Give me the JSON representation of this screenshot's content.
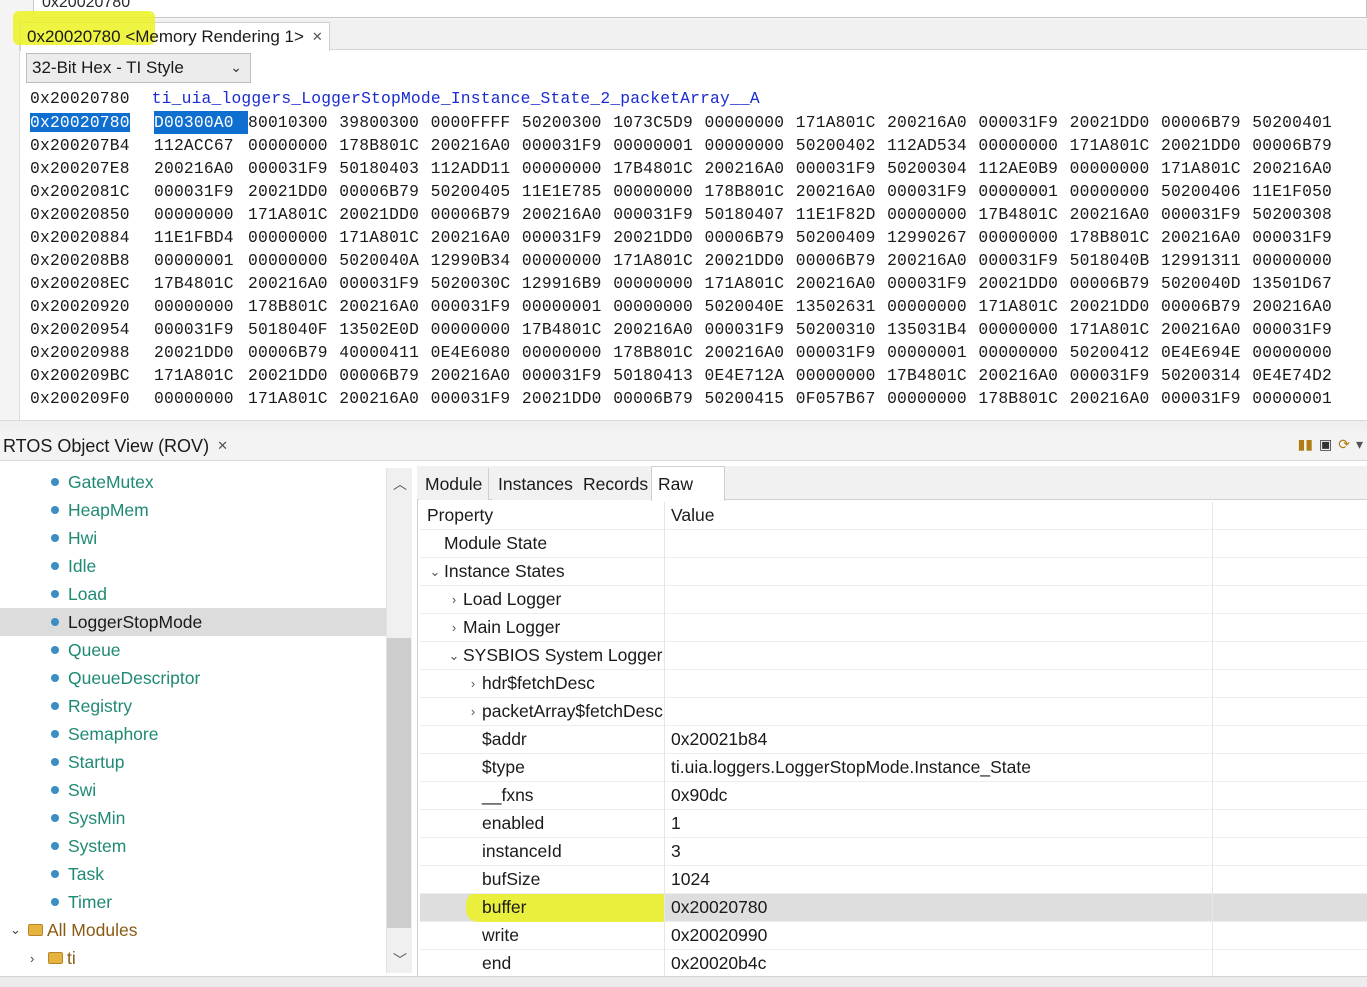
{
  "address_input": {
    "value": "0x20020780"
  },
  "memory_view": {
    "tab_title": "0x20020780 <Memory Rendering 1>",
    "format": "32-Bit Hex - TI Style",
    "label_row": {
      "address": "0x20020780",
      "symbol": "ti_uia_loggers_LoggerStopMode_Instance_State_2_packetArray__A"
    },
    "rows": [
      {
        "address": "0x20020780",
        "words": [
          "D00300A0",
          "80010300",
          "39800300",
          "0000FFFF",
          "50200300",
          "1073C5D9",
          "00000000",
          "171A801C",
          "200216A0",
          "000031F9",
          "20021DD0",
          "00006B79",
          "50200401"
        ]
      },
      {
        "address": "0x200207B4",
        "words": [
          "112ACC67",
          "00000000",
          "178B801C",
          "200216A0",
          "000031F9",
          "00000001",
          "00000000",
          "50200402",
          "112AD534",
          "00000000",
          "171A801C",
          "20021DD0",
          "00006B79"
        ]
      },
      {
        "address": "0x200207E8",
        "words": [
          "200216A0",
          "000031F9",
          "50180403",
          "112ADD11",
          "00000000",
          "17B4801C",
          "200216A0",
          "000031F9",
          "50200304",
          "112AE0B9",
          "00000000",
          "171A801C",
          "200216A0"
        ]
      },
      {
        "address": "0x2002081C",
        "words": [
          "000031F9",
          "20021DD0",
          "00006B79",
          "50200405",
          "11E1E785",
          "00000000",
          "178B801C",
          "200216A0",
          "000031F9",
          "00000001",
          "00000000",
          "50200406",
          "11E1F050"
        ]
      },
      {
        "address": "0x20020850",
        "words": [
          "00000000",
          "171A801C",
          "20021DD0",
          "00006B79",
          "200216A0",
          "000031F9",
          "50180407",
          "11E1F82D",
          "00000000",
          "17B4801C",
          "200216A0",
          "000031F9",
          "50200308"
        ]
      },
      {
        "address": "0x20020884",
        "words": [
          "11E1FBD4",
          "00000000",
          "171A801C",
          "200216A0",
          "000031F9",
          "20021DD0",
          "00006B79",
          "50200409",
          "12990267",
          "00000000",
          "178B801C",
          "200216A0",
          "000031F9"
        ]
      },
      {
        "address": "0x200208B8",
        "words": [
          "00000001",
          "00000000",
          "5020040A",
          "12990B34",
          "00000000",
          "171A801C",
          "20021DD0",
          "00006B79",
          "200216A0",
          "000031F9",
          "5018040B",
          "12991311",
          "00000000"
        ]
      },
      {
        "address": "0x200208EC",
        "words": [
          "17B4801C",
          "200216A0",
          "000031F9",
          "5020030C",
          "129916B9",
          "00000000",
          "171A801C",
          "200216A0",
          "000031F9",
          "20021DD0",
          "00006B79",
          "5020040D",
          "13501D67"
        ]
      },
      {
        "address": "0x20020920",
        "words": [
          "00000000",
          "178B801C",
          "200216A0",
          "000031F9",
          "00000001",
          "00000000",
          "5020040E",
          "13502631",
          "00000000",
          "171A801C",
          "20021DD0",
          "00006B79",
          "200216A0"
        ]
      },
      {
        "address": "0x20020954",
        "words": [
          "000031F9",
          "5018040F",
          "13502E0D",
          "00000000",
          "17B4801C",
          "200216A0",
          "000031F9",
          "50200310",
          "135031B4",
          "00000000",
          "171A801C",
          "200216A0",
          "000031F9"
        ]
      },
      {
        "address": "0x20020988",
        "words": [
          "20021DD0",
          "00006B79",
          "40000411",
          "0E4E6080",
          "00000000",
          "178B801C",
          "200216A0",
          "000031F9",
          "00000001",
          "00000000",
          "50200412",
          "0E4E694E",
          "00000000"
        ]
      },
      {
        "address": "0x200209BC",
        "words": [
          "171A801C",
          "20021DD0",
          "00006B79",
          "200216A0",
          "000031F9",
          "50180413",
          "0E4E712A",
          "00000000",
          "17B4801C",
          "200216A0",
          "000031F9",
          "50200314",
          "0E4E74D2"
        ]
      },
      {
        "address": "0x200209F0",
        "words": [
          "00000000",
          "171A801C",
          "200216A0",
          "000031F9",
          "20021DD0",
          "00006B79",
          "50200415",
          "0F057B67",
          "00000000",
          "178B801C",
          "200216A0",
          "000031F9",
          "00000001"
        ]
      }
    ]
  },
  "rov": {
    "title": "RTOS Object View (ROV)",
    "tree_items": [
      "GateMutex",
      "HeapMem",
      "Hwi",
      "Idle",
      "Load",
      "LoggerStopMode",
      "Queue",
      "QueueDescriptor",
      "Registry",
      "Semaphore",
      "Startup",
      "Swi",
      "SysMin",
      "System",
      "Task",
      "Timer"
    ],
    "selected_item": "LoggerStopMode",
    "folders": [
      {
        "label": "All Modules",
        "expanded": true
      },
      {
        "label": "ti",
        "expanded": false
      }
    ],
    "tabs": [
      "Module",
      "Instances",
      "Records",
      "Raw"
    ],
    "active_tab": "Raw",
    "grid_headers": {
      "property": "Property",
      "value": "Value"
    },
    "grid_rows": [
      {
        "property": "Module State",
        "value": "",
        "indent": 0,
        "toggle": "none"
      },
      {
        "property": "Instance States",
        "value": "",
        "indent": 0,
        "toggle": "expanded"
      },
      {
        "property": "Load Logger",
        "value": "",
        "indent": 1,
        "toggle": "collapsed"
      },
      {
        "property": "Main Logger",
        "value": "",
        "indent": 1,
        "toggle": "collapsed"
      },
      {
        "property": "SYSBIOS System Logger",
        "value": "",
        "indent": 1,
        "toggle": "expanded"
      },
      {
        "property": "hdr$fetchDesc",
        "value": "",
        "indent": 2,
        "toggle": "collapsed"
      },
      {
        "property": "packetArray$fetchDesc",
        "value": "",
        "indent": 2,
        "toggle": "collapsed"
      },
      {
        "property": "$addr",
        "value": "0x20021b84",
        "indent": 2,
        "toggle": "none"
      },
      {
        "property": "$type",
        "value": "ti.uia.loggers.LoggerStopMode.Instance_State",
        "indent": 2,
        "toggle": "none"
      },
      {
        "property": "__fxns",
        "value": "0x90dc",
        "indent": 2,
        "toggle": "none"
      },
      {
        "property": "enabled",
        "value": "1",
        "indent": 2,
        "toggle": "none"
      },
      {
        "property": "instanceId",
        "value": "3",
        "indent": 2,
        "toggle": "none"
      },
      {
        "property": "bufSize",
        "value": "1024",
        "indent": 2,
        "toggle": "none"
      },
      {
        "property": "buffer",
        "value": "0x20020780",
        "indent": 2,
        "toggle": "none",
        "highlight": true
      },
      {
        "property": "write",
        "value": "0x20020990",
        "indent": 2,
        "toggle": "none"
      },
      {
        "property": "end",
        "value": "0x20020b4c",
        "indent": 2,
        "toggle": "none"
      }
    ]
  },
  "colors": {
    "highlight_marker": "#ecf222",
    "selection_blue": "#0f6fd1",
    "symbol_blue": "#1a2bd0",
    "tree_text": "#1f8a74"
  }
}
